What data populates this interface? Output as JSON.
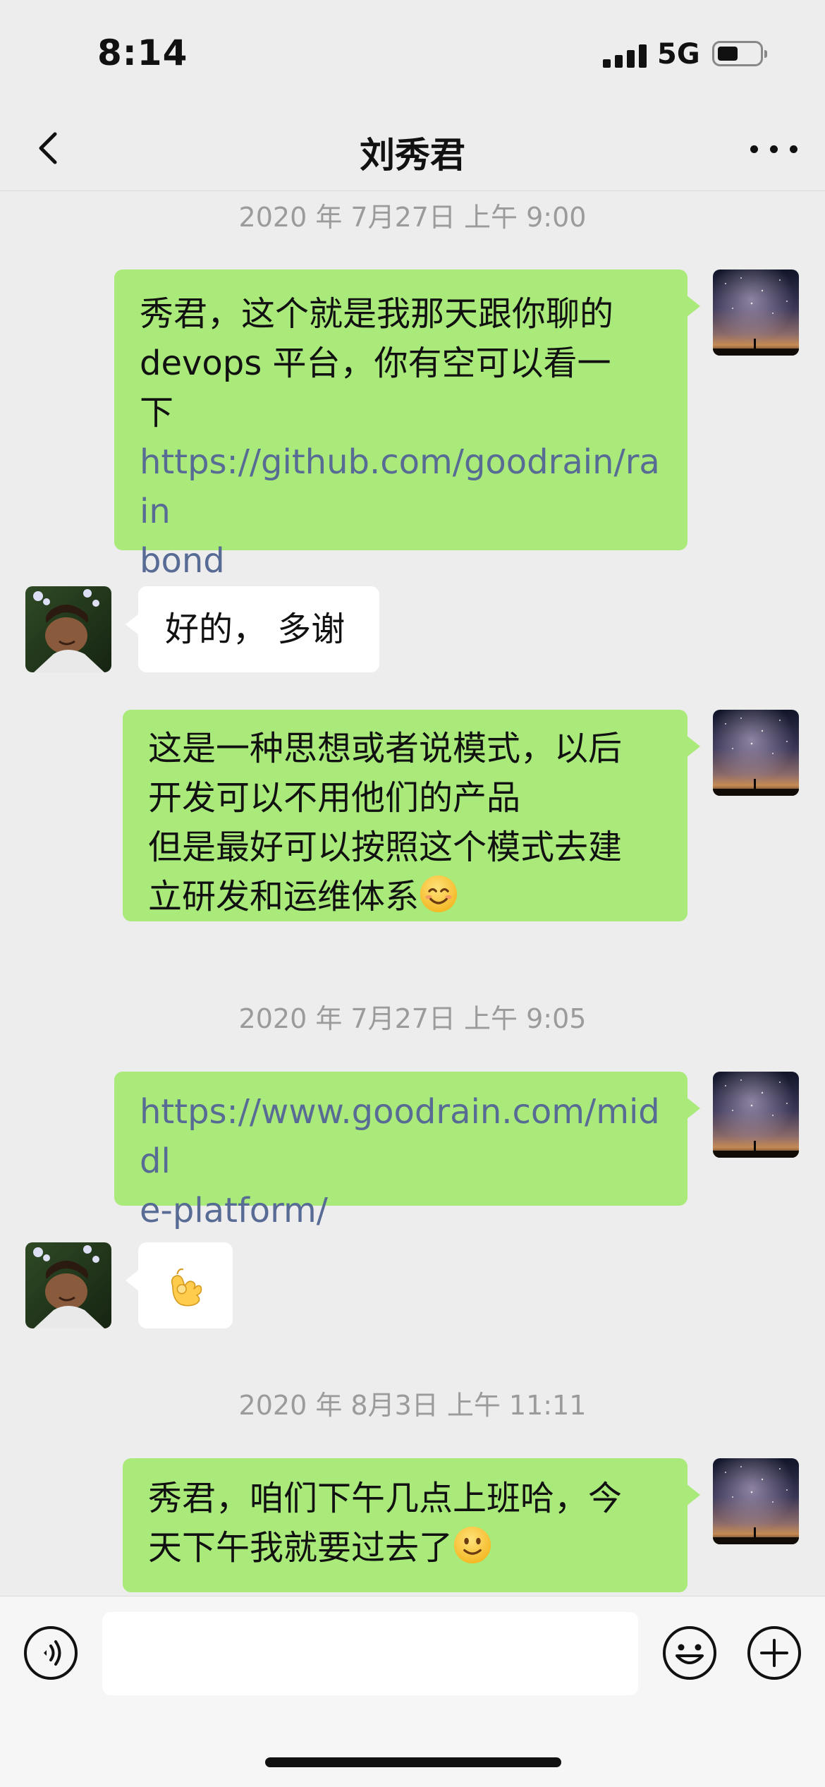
{
  "status_bar": {
    "time": "8:14",
    "network": "5G",
    "signal_bars": 4,
    "battery_level": 0.5
  },
  "nav": {
    "title": "刘秀君",
    "back_icon": "chevron-left-icon",
    "more_icon": "more-dots-icon"
  },
  "messages": [
    {
      "type": "timestamp",
      "text": "2020 年 7月27日 上午 9:00"
    },
    {
      "type": "message",
      "sender": "me",
      "lines": [
        "秀君，这个就是我那天跟你聊的",
        "devops 平台，你有空可以看一",
        "下"
      ],
      "link": [
        "https://github.com/goodrain/rain",
        "bond"
      ]
    },
    {
      "type": "message",
      "sender": "them",
      "text": "好的， 多谢"
    },
    {
      "type": "message",
      "sender": "me",
      "lines": [
        "这是一种思想或者说模式，以后",
        "开发可以不用他们的产品",
        "但是最好可以按照这个模式去建"
      ],
      "last_line": "立研发和运维体系",
      "emoji": "smiling-face-emoji"
    },
    {
      "type": "timestamp",
      "text": "2020 年 7月27日 上午 9:05"
    },
    {
      "type": "message",
      "sender": "me",
      "link": [
        "https://www.goodrain.com/middl",
        "e-platform/"
      ]
    },
    {
      "type": "message",
      "sender": "them",
      "emoji": "ok-hand-emoji"
    },
    {
      "type": "timestamp",
      "text": "2020 年 8月3日 上午 11:11"
    },
    {
      "type": "message",
      "sender": "me",
      "lines": [
        "秀君，咱们下午几点上班哈，今"
      ],
      "last_line": "天下午我就要过去了",
      "emoji": "slightly-smiling-face-emoji"
    }
  ],
  "input_bar": {
    "voice_icon": "voice-icon",
    "input_value": "",
    "emoji_icon": "emoji-icon",
    "add_icon": "plus-icon"
  },
  "colors": {
    "background": "#ededed",
    "my_bubble": "#a9ea7a",
    "their_bubble": "#ffffff",
    "link": "#576b95",
    "timestamp": "#9b9b9b"
  }
}
